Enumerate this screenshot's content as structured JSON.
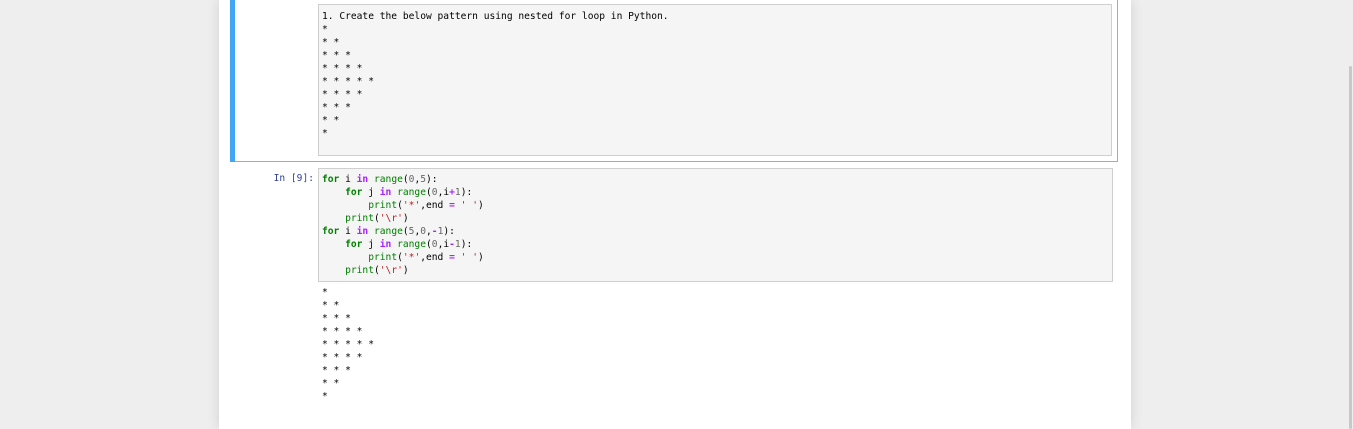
{
  "markdown_cell": {
    "text": "1. Create the below pattern using nested for loop in Python.\n*\n* *\n* * *\n* * * *\n* * * * *\n* * * *\n* * *\n* *\n*"
  },
  "code_cell": {
    "prompt": "In [9]:",
    "output": "*\n* *\n* * *\n* * * *\n* * * * *\n* * * *\n* * *\n* *\n*"
  },
  "code_lines": [
    [
      [
        "kw",
        "for"
      ],
      [
        "nn",
        " i "
      ],
      [
        "op",
        "in"
      ],
      [
        "nn",
        " "
      ],
      [
        "nb",
        "range"
      ],
      [
        "nn",
        "("
      ],
      [
        "mi",
        "0"
      ],
      [
        "nn",
        ","
      ],
      [
        "mi",
        "5"
      ],
      [
        "nn",
        "):"
      ]
    ],
    [
      [
        "nn",
        "    "
      ],
      [
        "kw",
        "for"
      ],
      [
        "nn",
        " j "
      ],
      [
        "op",
        "in"
      ],
      [
        "nn",
        " "
      ],
      [
        "nb",
        "range"
      ],
      [
        "nn",
        "("
      ],
      [
        "mi",
        "0"
      ],
      [
        "nn",
        ",i"
      ],
      [
        "op",
        "+"
      ],
      [
        "mi",
        "1"
      ],
      [
        "nn",
        "):"
      ]
    ],
    [
      [
        "nn",
        "        "
      ],
      [
        "nb",
        "print"
      ],
      [
        "nn",
        "("
      ],
      [
        "st",
        "'*'"
      ],
      [
        "nn",
        ",end "
      ],
      [
        "op",
        "="
      ],
      [
        "nn",
        " "
      ],
      [
        "st",
        "' '"
      ],
      [
        "nn",
        ")"
      ]
    ],
    [
      [
        "nn",
        "    "
      ],
      [
        "nb",
        "print"
      ],
      [
        "nn",
        "("
      ],
      [
        "st",
        "'\\r'"
      ],
      [
        "nn",
        ")"
      ]
    ],
    [
      [
        "kw",
        "for"
      ],
      [
        "nn",
        " i "
      ],
      [
        "op",
        "in"
      ],
      [
        "nn",
        " "
      ],
      [
        "nb",
        "range"
      ],
      [
        "nn",
        "("
      ],
      [
        "mi",
        "5"
      ],
      [
        "nn",
        ","
      ],
      [
        "mi",
        "0"
      ],
      [
        "nn",
        ","
      ],
      [
        "op",
        "-"
      ],
      [
        "mi",
        "1"
      ],
      [
        "nn",
        "):"
      ]
    ],
    [
      [
        "nn",
        "    "
      ],
      [
        "kw",
        "for"
      ],
      [
        "nn",
        " j "
      ],
      [
        "op",
        "in"
      ],
      [
        "nn",
        " "
      ],
      [
        "nb",
        "range"
      ],
      [
        "nn",
        "("
      ],
      [
        "mi",
        "0"
      ],
      [
        "nn",
        ",i"
      ],
      [
        "op",
        "-"
      ],
      [
        "mi",
        "1"
      ],
      [
        "nn",
        "):"
      ]
    ],
    [
      [
        "nn",
        "        "
      ],
      [
        "nb",
        "print"
      ],
      [
        "nn",
        "("
      ],
      [
        "st",
        "'*'"
      ],
      [
        "nn",
        ",end "
      ],
      [
        "op",
        "="
      ],
      [
        "nn",
        " "
      ],
      [
        "st",
        "' '"
      ],
      [
        "nn",
        ")"
      ]
    ],
    [
      [
        "nn",
        "    "
      ],
      [
        "nb",
        "print"
      ],
      [
        "nn",
        "("
      ],
      [
        "st",
        "'\\r'"
      ],
      [
        "nn",
        ")"
      ]
    ]
  ],
  "colors": {
    "selection_bar": "#42a5f5",
    "keyword": "#008000",
    "string": "#ba2121",
    "number": "#666666",
    "operator": "#aa22ff",
    "prompt": "#303f9f"
  }
}
